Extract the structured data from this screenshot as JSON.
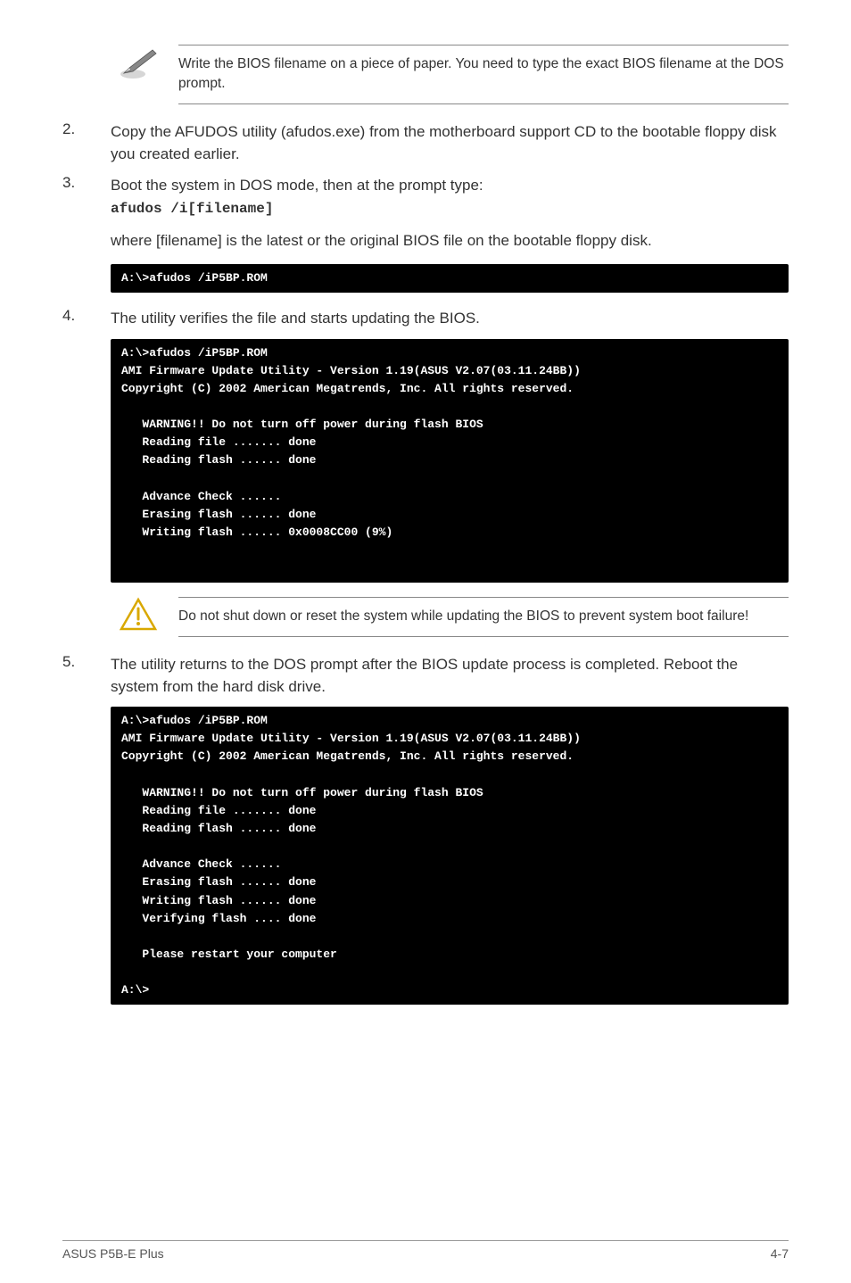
{
  "note1": {
    "text": "Write the BIOS filename on a piece of paper. You need to type the exact BIOS filename at the DOS prompt."
  },
  "steps": {
    "2": {
      "num": "2.",
      "text": "Copy the AFUDOS utility (afudos.exe) from the motherboard support CD to the bootable floppy disk you created earlier."
    },
    "3": {
      "num": "3.",
      "text": "Boot the system in DOS mode, then at the prompt type:",
      "cmd": "afudos /i[filename]",
      "sub": "where [filename] is the latest or the original BIOS file on the bootable floppy disk."
    },
    "4": {
      "num": "4.",
      "text": "The utility verifies the file and starts updating the BIOS."
    },
    "5": {
      "num": "5.",
      "text": "The utility returns to the DOS prompt after the BIOS update process is completed. Reboot the system from the hard disk drive."
    }
  },
  "terminal1": "A:\\>afudos /iP5BP.ROM",
  "terminal2": "A:\\>afudos /iP5BP.ROM\nAMI Firmware Update Utility - Version 1.19(ASUS V2.07(03.11.24BB))\nCopyright (C) 2002 American Megatrends, Inc. All rights reserved.\n\n   WARNING!! Do not turn off power during flash BIOS\n   Reading file ....... done\n   Reading flash ...... done\n\n   Advance Check ......\n   Erasing flash ...... done\n   Writing flash ...... 0x0008CC00 (9%)\n\n\n",
  "note2": {
    "text": "Do not shut down or reset the system while updating the BIOS to prevent system boot failure!"
  },
  "terminal3": "A:\\>afudos /iP5BP.ROM\nAMI Firmware Update Utility - Version 1.19(ASUS V2.07(03.11.24BB))\nCopyright (C) 2002 American Megatrends, Inc. All rights reserved.\n\n   WARNING!! Do not turn off power during flash BIOS\n   Reading file ....... done\n   Reading flash ...... done\n\n   Advance Check ......\n   Erasing flash ...... done\n   Writing flash ...... done\n   Verifying flash .... done\n\n   Please restart your computer\n\nA:\\>",
  "footer": {
    "left": "ASUS P5B-E Plus",
    "right": "4-7"
  }
}
